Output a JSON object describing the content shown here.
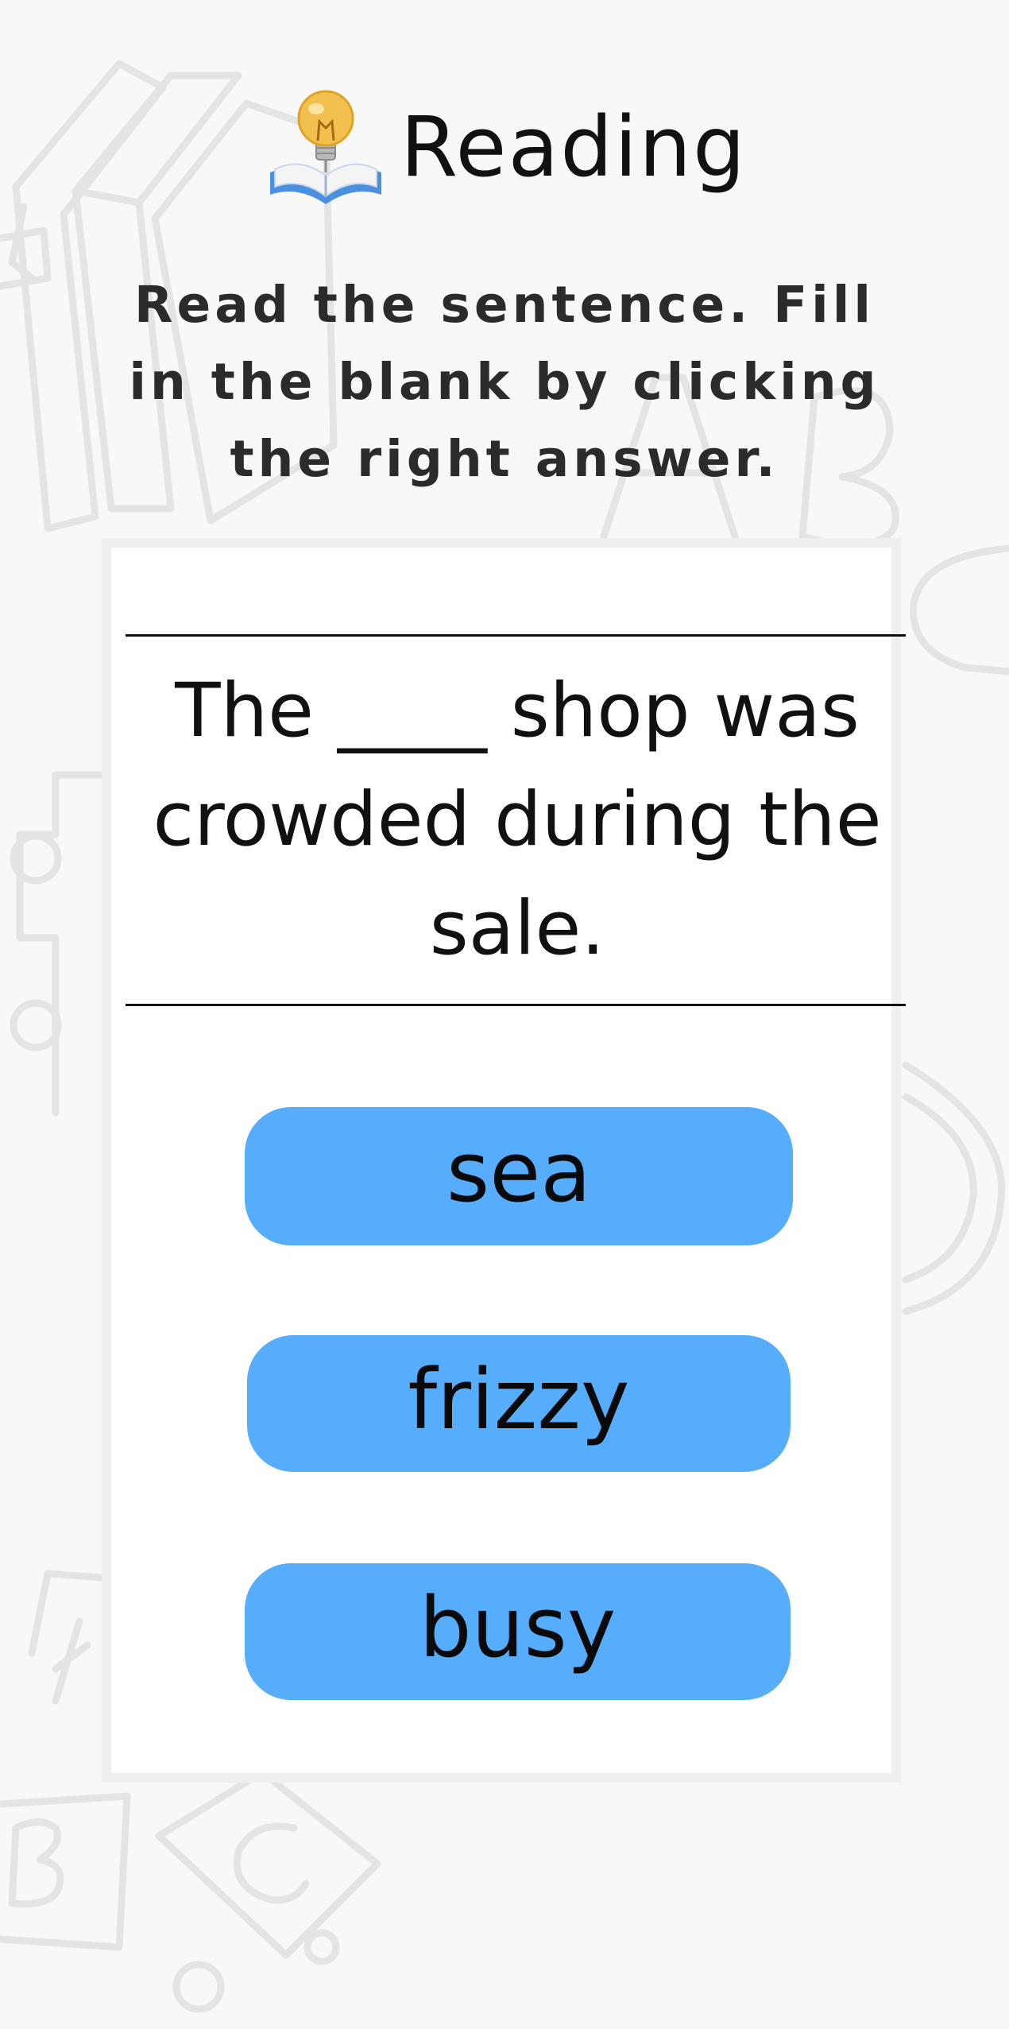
{
  "header": {
    "title": "Reading",
    "icon": "lightbulb-book-icon"
  },
  "instructions": "Read the sentence. Fill in the blank by clicking the right answer.",
  "question": {
    "sentence": "The ____ shop was crowded during the sale."
  },
  "options": [
    {
      "label": "sea"
    },
    {
      "label": "frizzy"
    },
    {
      "label": "busy"
    }
  ],
  "colors": {
    "background": "#f8f8f8",
    "card": "#ffffff",
    "card_border": "#efefef",
    "option_fill": "#55adfc",
    "text": "#111111"
  }
}
